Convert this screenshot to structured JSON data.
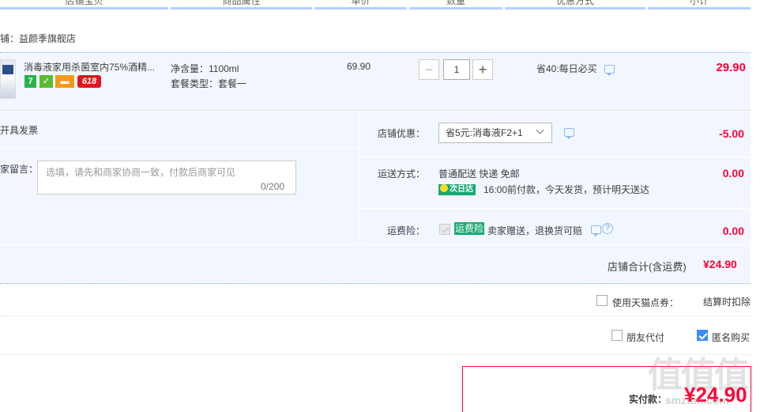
{
  "header": {
    "columns": [
      "店铺宝贝",
      "商品属性",
      "单价",
      "数量",
      "优惠方式",
      "小计"
    ]
  },
  "shop": {
    "label": "铺：益颜季旗舰店"
  },
  "item": {
    "title": "消毒液家用杀菌室内75%酒精...",
    "badges": [
      "7",
      "",
      "",
      "618"
    ],
    "attr1": "净含量：1100ml",
    "attr2": "套餐类型：套餐一",
    "unit_price": "69.90",
    "quantity": "1",
    "minus": "−",
    "plus": "+",
    "discount": "省40:每日必买",
    "subtotal": "29.90"
  },
  "invoice": {
    "label": "开具发票"
  },
  "message": {
    "label": "家留言：",
    "placeholder": "选填，请先和商家协商一致，付款后商家可见",
    "count": "0/200"
  },
  "coupon": {
    "label": "店铺优惠：",
    "selected": "省5元:消毒液F2+1",
    "amount": "-5.00"
  },
  "shipping": {
    "label": "运送方式：",
    "method": "普通配送 快递 免邮",
    "tag": "次日达",
    "note": "16:00前付款，今天发货，预计明天送达",
    "amount": "0.00"
  },
  "insurance": {
    "label": "运费险：",
    "tag": "运费险",
    "note": "卖家赠送，退换货可赔",
    "help": "?",
    "amount": "0.00"
  },
  "shop_total": {
    "label": "店铺合计(含运费)",
    "amount": "¥24.90"
  },
  "points": {
    "label": "使用天猫点券：",
    "note": "结算时扣除"
  },
  "options": {
    "friend_pay": "朋友代付",
    "anonymous": "匿名购买"
  },
  "payment": {
    "label": "实付款：",
    "amount": "¥24.90"
  },
  "watermark": {
    "text": "值值值",
    "sub": "smzdm.com"
  },
  "colors": {
    "accent": "#ff0036",
    "panel": "#f2f7ff",
    "green": "#19a974",
    "blue": "#3b8ef5"
  }
}
